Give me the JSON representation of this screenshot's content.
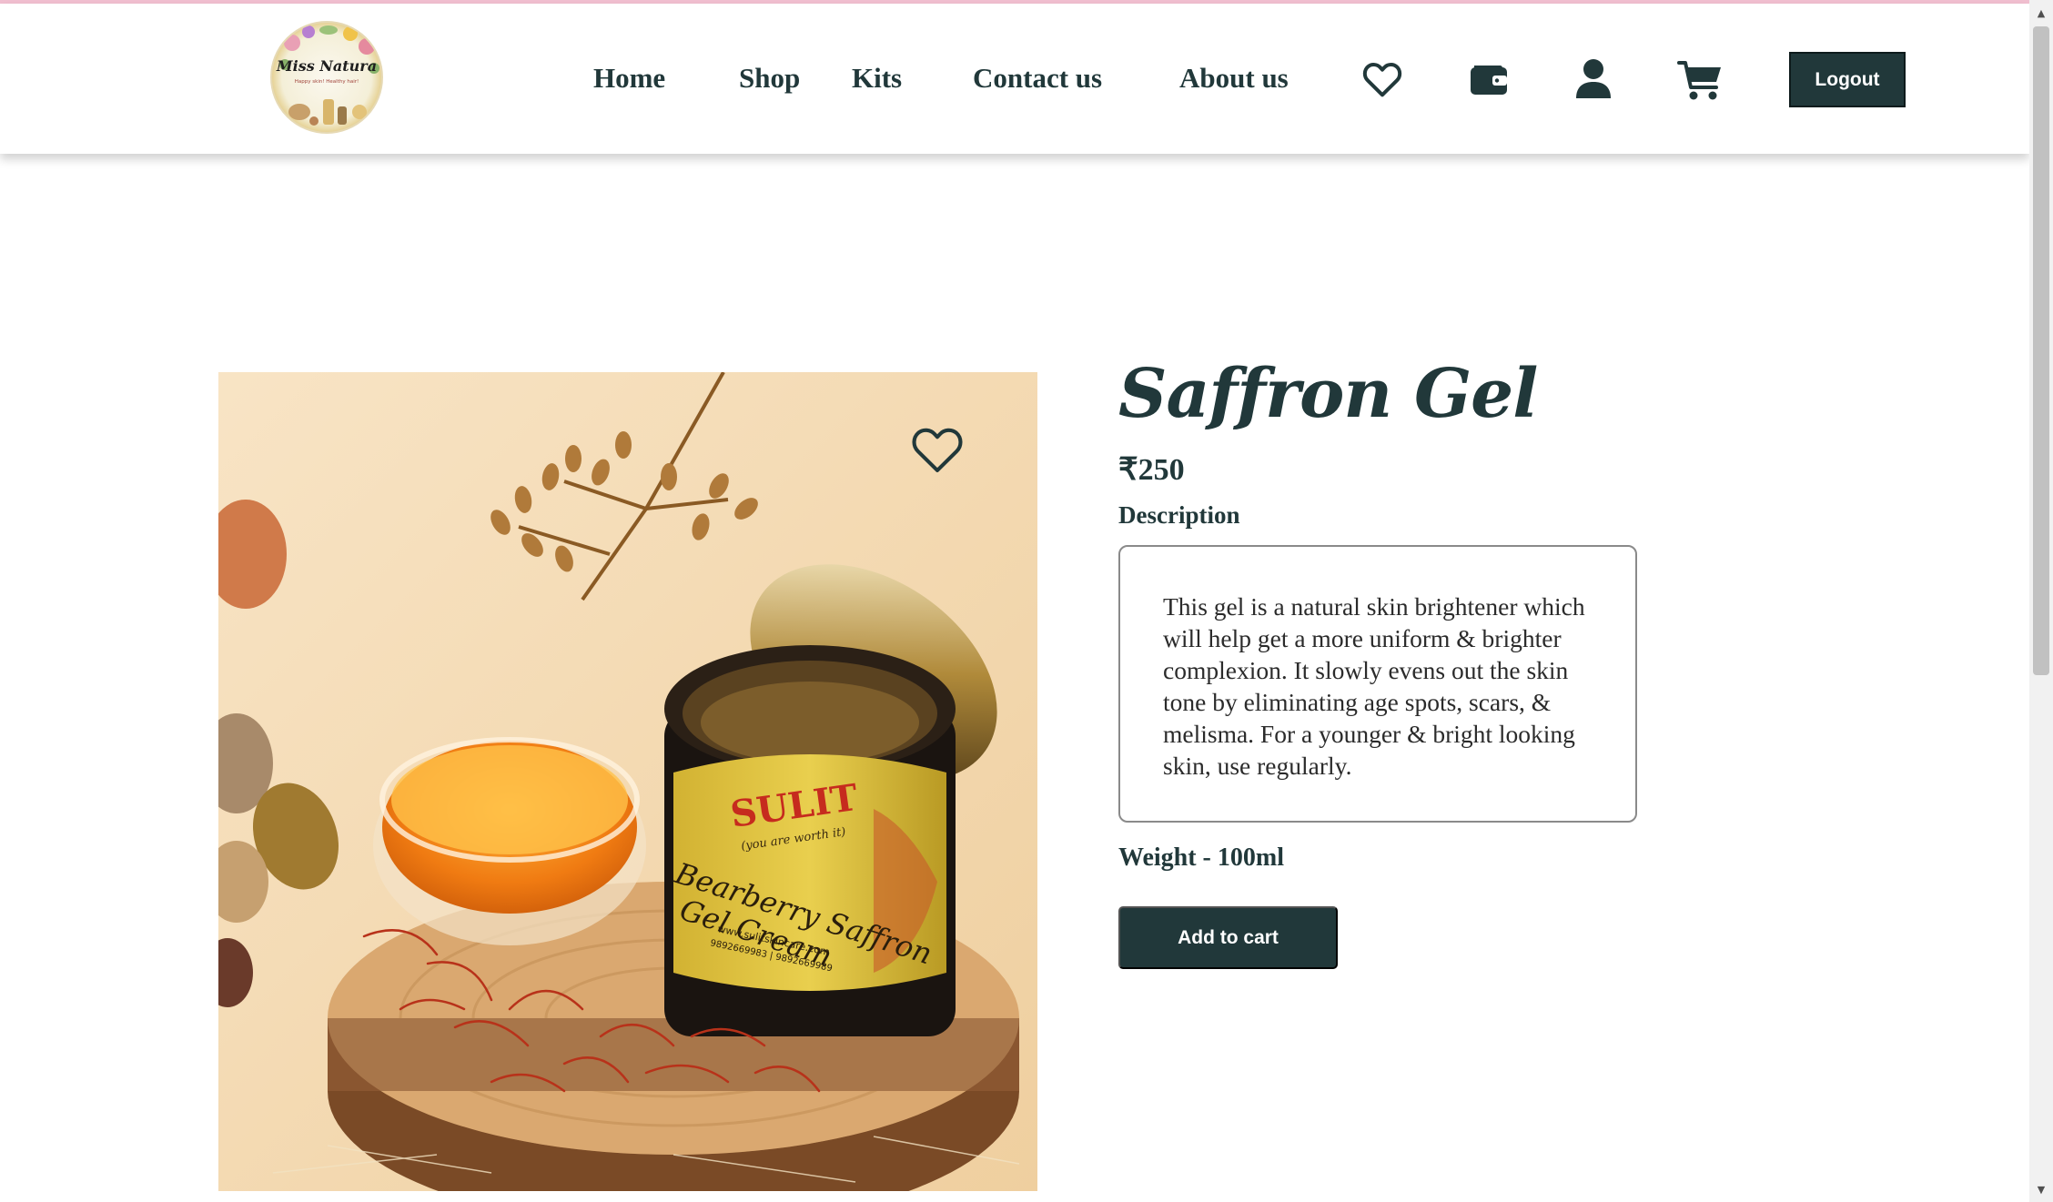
{
  "brand": {
    "logo_text": "Miss Natura",
    "logo_tagline": "Happy skin! Healthy hair!"
  },
  "nav": {
    "links": [
      "Home",
      "Shop",
      "Kits",
      "Contact us",
      "About us"
    ],
    "icons": [
      "heart-icon",
      "wallet-icon",
      "user-icon",
      "cart-icon"
    ],
    "logout_label": "Logout"
  },
  "product": {
    "title": "Saffron Gel",
    "price": "₹250",
    "description_label": "Description",
    "description": "This gel is a natural skin brightener which will help get a more uniform & brighter complexion. It slowly evens out the skin tone by eliminating age spots, scars, & melisma. For a younger & bright looking skin, use regularly.",
    "weight": "Weight - 100ml",
    "add_to_cart_label": "Add to cart",
    "image": {
      "jar_brand": "SULIT",
      "jar_tagline": "(you are worth it)",
      "jar_line1": "Bearberry Saffron",
      "jar_line2": "Gel Cream",
      "jar_site": "www.sulitskincare.com",
      "jar_phone": "9892669983 | 9892669989"
    }
  },
  "colors": {
    "primary": "#21383a",
    "accent_line": "#f1bfd0",
    "background": "#ffffff"
  }
}
